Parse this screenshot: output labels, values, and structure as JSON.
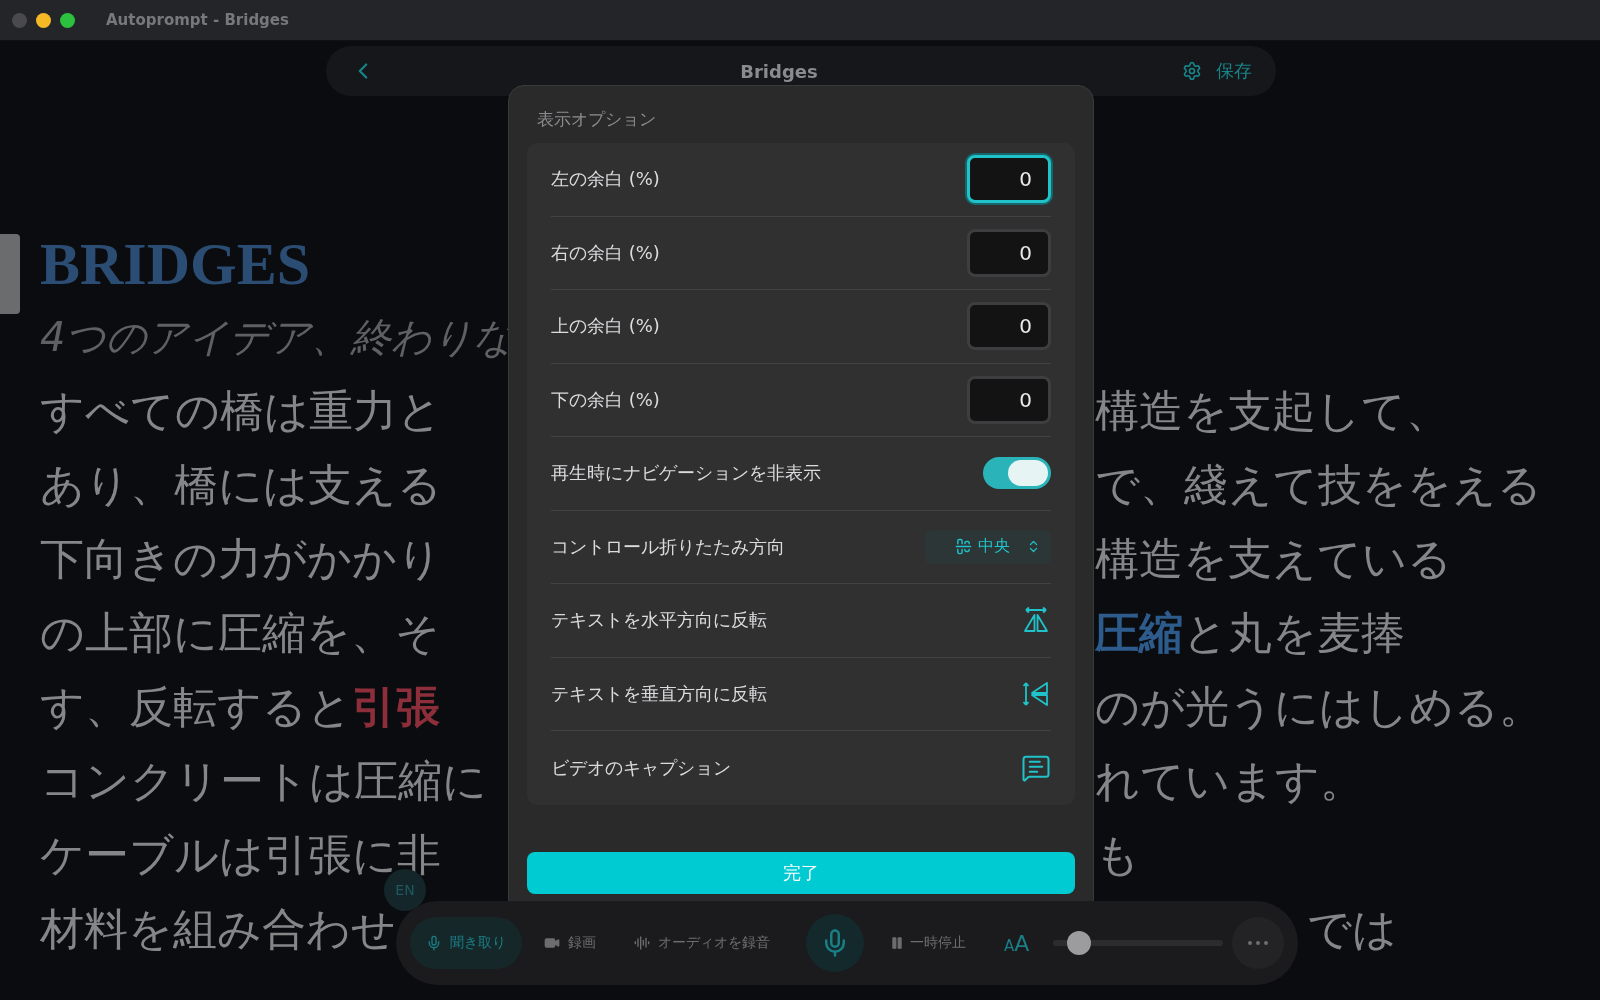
{
  "window": {
    "title": "Autoprompt - Bridges"
  },
  "nav": {
    "title": "Bridges",
    "save": "保存"
  },
  "document": {
    "title": "BRIDGES",
    "subtitle": "4つのアイデア、終わりな",
    "lines": [
      {
        "kind": "normal",
        "left": [
          {
            "kind": "plain",
            "text": "すべての橋は重力と"
          }
        ],
        "right": [
          {
            "kind": "plain",
            "text": "構造を支起して、"
          }
        ]
      },
      {
        "kind": "normal",
        "left": [
          {
            "kind": "plain",
            "text": "あり、橋には支える"
          }
        ],
        "right": [
          {
            "kind": "plain",
            "text": "で、綫えて技ををえる"
          }
        ]
      },
      {
        "kind": "normal",
        "left": [
          {
            "kind": "plain",
            "text": "下向きの力がかかり"
          }
        ],
        "right": [
          {
            "kind": "plain",
            "text": "構造を支えている"
          }
        ]
      },
      {
        "kind": "normal",
        "left": [
          {
            "kind": "plain",
            "text": "の上部に圧縮を、そ"
          }
        ],
        "right": [
          {
            "kind": "compression",
            "text": "圧縮"
          },
          {
            "kind": "plain",
            "text": "と丸を麦捧"
          }
        ]
      },
      {
        "kind": "normal",
        "left": [
          {
            "kind": "plain",
            "text": "す、反転すると"
          },
          {
            "kind": "tension",
            "text": "引張"
          }
        ],
        "right": [
          {
            "kind": "plain",
            "text": "のが光うにはしめる。"
          }
        ]
      },
      {
        "kind": "normal",
        "left": [
          {
            "kind": "plain",
            "text": "コンクリートは圧縮に"
          }
        ],
        "right": [
          {
            "kind": "plain",
            "text": "れています。"
          }
        ]
      },
      {
        "kind": "normal",
        "left": [
          {
            "kind": "plain",
            "text": "ケーブルは引張に非"
          }
        ],
        "right": [
          {
            "kind": "plain",
            "text": "も"
          }
        ]
      },
      {
        "kind": "tail",
        "left": [
          {
            "kind": "plain",
            "text": "材料を組み合わせ"
          }
        ],
        "right": [
          {
            "kind": "plain",
            "text": "では"
          }
        ]
      }
    ]
  },
  "lang_badge": "EN",
  "modal": {
    "title": "表示オプション",
    "rows": [
      {
        "kind": "number",
        "label": "左の余白 (%)",
        "value": "0",
        "focused": true
      },
      {
        "kind": "number",
        "label": "右の余白 (%)",
        "value": "0",
        "focused": false
      },
      {
        "kind": "number",
        "label": "上の余白 (%)",
        "value": "0",
        "focused": false
      },
      {
        "kind": "number",
        "label": "下の余白 (%)",
        "value": "0",
        "focused": false
      },
      {
        "kind": "toggle",
        "label": "再生時にナビゲーションを非表示",
        "on": true
      },
      {
        "kind": "select",
        "label": "コントロール折りたたみ方向",
        "value": "中央"
      },
      {
        "kind": "flip_horizontal",
        "label": "テキストを水平方向に反転"
      },
      {
        "kind": "flip_vertical",
        "label": "テキストを垂直方向に反転"
      },
      {
        "kind": "captions",
        "label": "ビデオのキャプション"
      }
    ],
    "done": "完了"
  },
  "toolbar": {
    "modes": [
      {
        "kind": "listen",
        "label": "聞き取り",
        "selected": true
      },
      {
        "kind": "video",
        "label": "録画",
        "selected": false
      },
      {
        "kind": "audio",
        "label": "オーディオを録音",
        "selected": false
      }
    ],
    "pause": "一時停止",
    "text_size": "AA",
    "size_slider": {
      "level": 0.15
    }
  }
}
